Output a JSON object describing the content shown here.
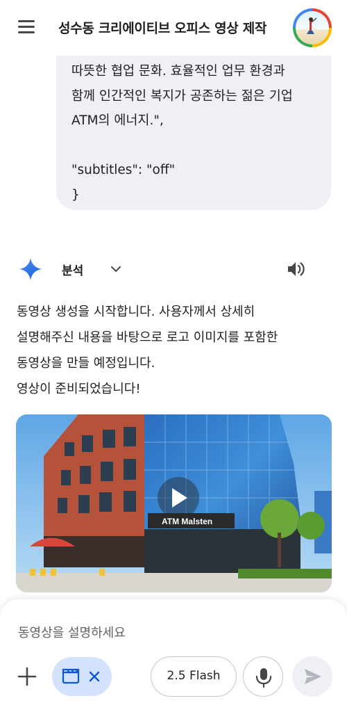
{
  "header": {
    "title": "성수동 크리에이티브 오피스 영상 제작",
    "menu_icon": "hamburger-menu-icon",
    "avatar_icon": "profile-avatar"
  },
  "user_message": {
    "text": "따뜻한 협업 문화. 효율적인 업무 환경과\n함께 인간적인 복지가 공존하는 젊은 기업\nATM의 에너지.\",\n\n  \"subtitles\": \"off\"\n}"
  },
  "response": {
    "model_label": "분석",
    "lines": [
      "동영상 생성을 시작합니다. 사용자께서 상세히",
      "설명해주신 내용을 바탕으로 로고 이미지를 포함한",
      "동영상을 만들 예정입니다.",
      "영상이 준비되었습니다!"
    ],
    "video": {
      "building_sign": "ATM Malsten"
    }
  },
  "composer": {
    "placeholder": "동영상을 설명하세요",
    "model_chip": "2.5 Flash"
  },
  "colors": {
    "accent_blue": "#1a73e8",
    "chip_bg": "#d3e3fd",
    "bubble_bg": "#eef0f5"
  }
}
